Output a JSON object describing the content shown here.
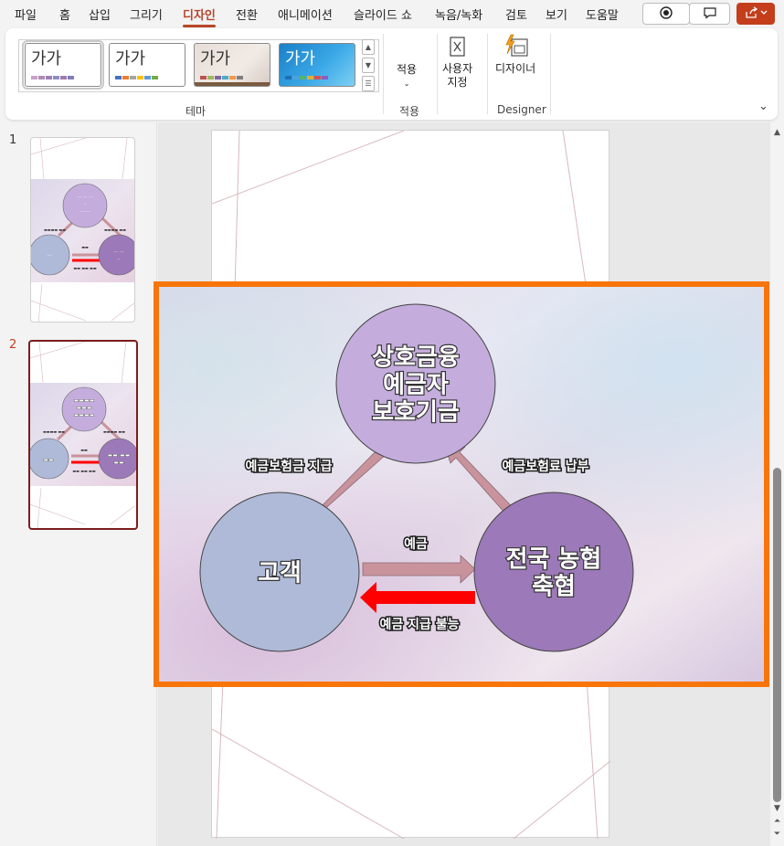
{
  "menu": {
    "tabs": [
      "파일",
      "홈",
      "삽입",
      "그리기",
      "디자인",
      "전환",
      "애니메이션",
      "슬라이드 쇼",
      "녹음/녹화",
      "검토",
      "보기",
      "도움말"
    ],
    "active_tab": "디자인"
  },
  "ribbon": {
    "themes": [
      {
        "label": "가가",
        "swatches": [
          "#c9a0c9",
          "#b38ab3",
          "#9a7fb8",
          "#8c8cc4",
          "#a07ab0",
          "#7e7eb8"
        ]
      },
      {
        "label": "가가",
        "swatches": [
          "#4472c4",
          "#ed7d31",
          "#a5a5a5",
          "#ffc000",
          "#5b9bd5",
          "#70ad47"
        ]
      },
      {
        "label": "가가",
        "swatches": [
          "#c0504d",
          "#9bbb59",
          "#8064a2",
          "#4bacc6",
          "#f79646",
          "#7f7f7f"
        ]
      },
      {
        "label": "가가",
        "swatches": [
          "#1f6fb5",
          "#4aa3df",
          "#57b36c",
          "#e0b030",
          "#d55050",
          "#8a5cc4"
        ]
      }
    ],
    "theme_group_label": "테마",
    "apply_button_label": "적용",
    "apply_group_label": "적용",
    "custom_button_line1": "사용자",
    "custom_button_line2": "지정",
    "designer_button_label": "디자이너",
    "designer_group_label": "Designer"
  },
  "slides_pane": {
    "slide_numbers": [
      "1",
      "2"
    ],
    "active_slide": "2"
  },
  "slide": {
    "top_circle": "상호금융\n예금자\n보호기금",
    "left_circle": "고객",
    "right_circle": "전국 농협\n축협",
    "label_left": "예금보험금 지급",
    "label_right": "예금보험료 납부",
    "label_deposit": "예금",
    "label_return": "예금 지급 불능"
  },
  "colors": {
    "accent": "#b7472a",
    "share_button": "#c43e1c",
    "selection_border": "#f8750a",
    "active_thumb_border": "#7b1c1c",
    "top_circle": "#c4addd",
    "left_circle": "#aebad8",
    "right_circle": "#9c79b8",
    "arrow": "#c9939b",
    "red_arrow": "#ff0000"
  },
  "icons": {
    "record": "record-icon",
    "comments": "comment-icon",
    "share": "share-icon",
    "designer": "designer-icon",
    "customize": "slide-size-icon"
  }
}
